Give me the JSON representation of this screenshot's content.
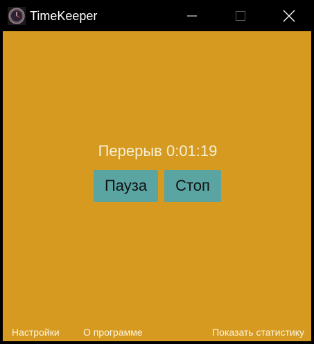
{
  "window": {
    "title": "TimeKeeper",
    "icon": "stopwatch-icon",
    "controls": {
      "minimize": "minimize-icon",
      "maximize": "maximize-icon",
      "close": "close-icon"
    }
  },
  "colors": {
    "background": "#d69a20",
    "button": "#5aa4a2",
    "titlebar": "#000000"
  },
  "timer": {
    "status_text": "Перерыв 0:01:19"
  },
  "buttons": {
    "pause_label": "Пауза",
    "stop_label": "Стоп"
  },
  "footer": {
    "settings_label": "Настройки",
    "about_label": "О программе",
    "stats_label": "Показать статистику"
  }
}
